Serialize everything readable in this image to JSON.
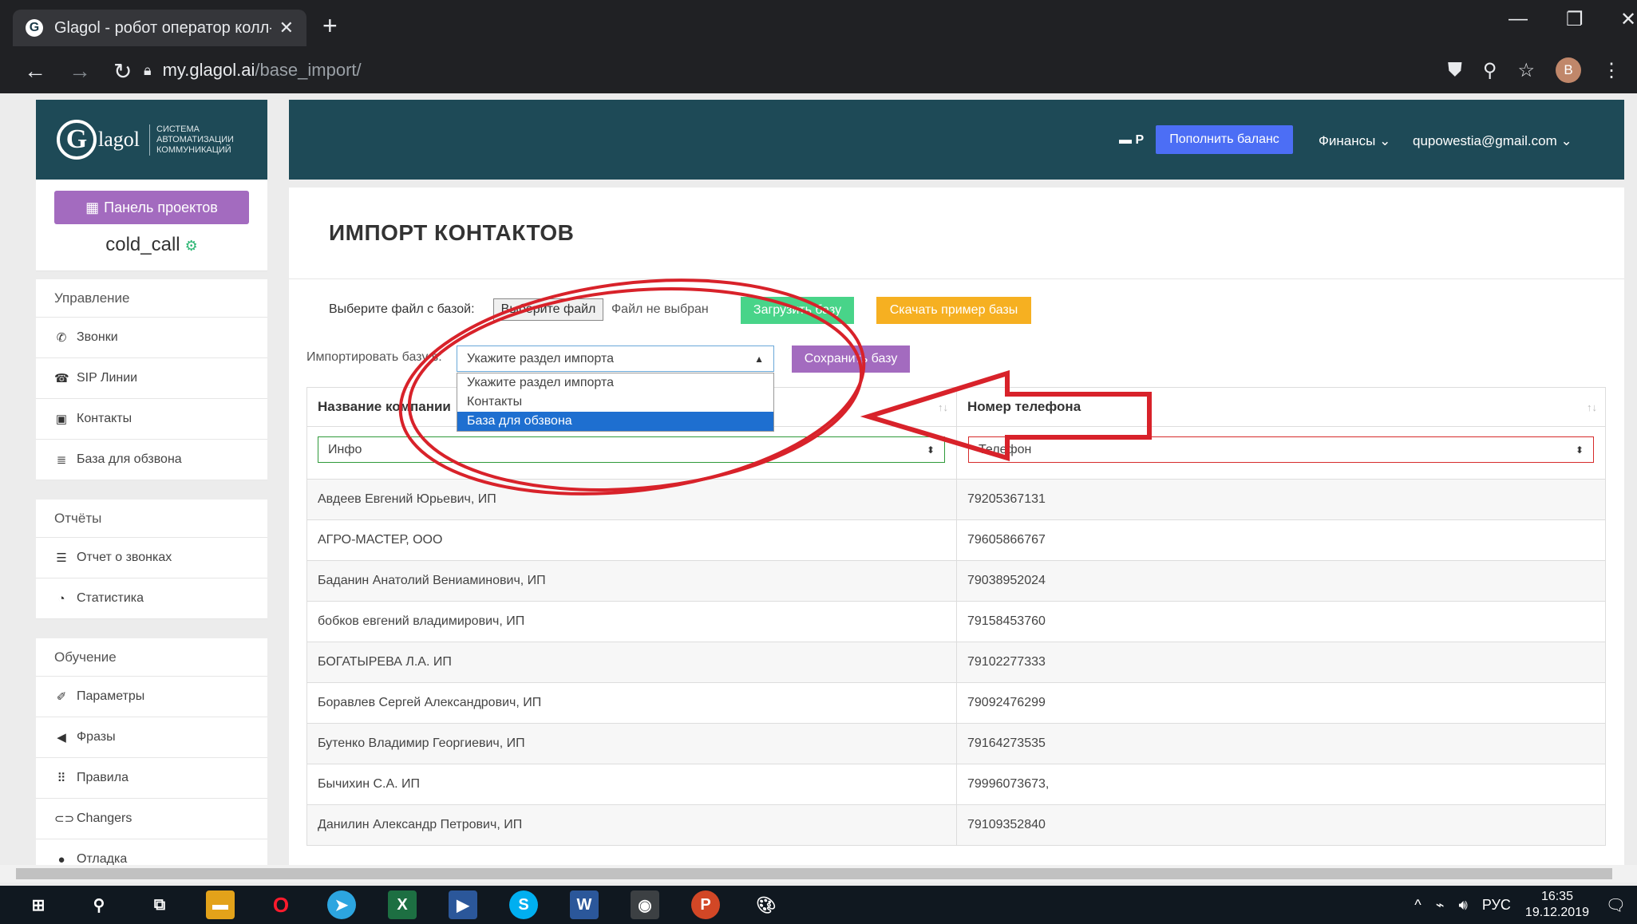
{
  "browser": {
    "tab_title": "Glagol - робот оператор колл-ц",
    "tab_close": "✕",
    "new_tab": "+",
    "url_host": "my.glagol.ai",
    "url_path": "/base_import/",
    "avatar_letter": "B",
    "win_min": "—",
    "win_restore": "❐",
    "win_close": "✕"
  },
  "logo": {
    "letter": "G",
    "word": "lagol",
    "subtitle": [
      "СИСТЕМА",
      "АВТОМАТИЗАЦИИ",
      "КОММУНИКАЦИЙ"
    ]
  },
  "sidebar": {
    "projects_button": "Панель проектов",
    "project_name": "cold_call",
    "groups": [
      {
        "title": "Управление",
        "items": [
          {
            "icon": "phone-icon",
            "glyph": "✆",
            "label": "Звонки"
          },
          {
            "icon": "sip-icon",
            "glyph": "☎",
            "label": "SIP Линии"
          },
          {
            "icon": "contacts-icon",
            "glyph": "▣",
            "label": "Контакты"
          },
          {
            "icon": "database-icon",
            "glyph": "≣",
            "label": "База для обзвона"
          }
        ]
      },
      {
        "title": "Отчёты",
        "items": [
          {
            "icon": "list-icon",
            "glyph": "☰",
            "label": "Отчет о звонках"
          },
          {
            "icon": "pie-chart-icon",
            "glyph": "◔",
            "label": "Статистика"
          }
        ]
      },
      {
        "title": "Обучение",
        "items": [
          {
            "icon": "params-icon",
            "glyph": "✐",
            "label": "Параметры"
          },
          {
            "icon": "megaphone-icon",
            "glyph": "◀",
            "label": "Фразы"
          },
          {
            "icon": "rules-icon",
            "glyph": "⠿",
            "label": "Правила"
          },
          {
            "icon": "changers-icon",
            "glyph": "⊂⊃",
            "label": "Changers"
          },
          {
            "icon": "debug-icon",
            "glyph": "●",
            "label": "Отладка"
          }
        ]
      }
    ]
  },
  "header": {
    "currency": "Р",
    "topup_button": "Пополнить баланс",
    "finance_menu": "Финансы ⌄",
    "user_email": "qupowestia@gmail.com ⌄"
  },
  "main": {
    "title": "ИМПОРТ КОНТАКТОВ",
    "file_label": "Выберите файл с базой:",
    "file_button": "Выберите файл",
    "file_none": "Файл не выбран",
    "upload_button": "Загрузить базу",
    "sample_button": "Скачать пример базы",
    "import_label": "Импортировать базу в:",
    "section_select_value": "Укажите раздел импорта",
    "save_button": "Сохранить базу",
    "dropdown_options": [
      "Укажите раздел импорта",
      "Контакты",
      "База для обзвона"
    ],
    "dropdown_selected_index": 2,
    "columns": [
      "Название компании",
      "Номер телефона"
    ],
    "col1_mapping": "Инфо",
    "col2_mapping": "Телефон",
    "rows": [
      [
        "Авдеев Евгений Юрьевич, ИП",
        "79205367131"
      ],
      [
        "АГРО-МАСТЕР, ООО",
        "79605866767"
      ],
      [
        "Баданин Анатолий Вениаминович, ИП",
        "79038952024"
      ],
      [
        "бобков евгений владимирович, ИП",
        "79158453760"
      ],
      [
        "БОГАТЫРЕВА Л.А. ИП",
        "79102277333"
      ],
      [
        "Боравлев Сергей Александрович, ИП",
        "79092476299"
      ],
      [
        "Бутенко Владимир Георгиевич, ИП",
        "79164273535"
      ],
      [
        "Бычихин С.А. ИП",
        "79996073673,"
      ],
      [
        "Данилин Александр Петрович, ИП",
        "79109352840"
      ]
    ]
  },
  "taskbar": {
    "lang": "РУС",
    "time": "16:35",
    "date": "19.12.2019"
  },
  "colors": {
    "header_bg": "#1e4a57",
    "purple": "#a36bbf",
    "blue": "#4c6ef5",
    "green": "#48d489",
    "orange": "#f6b021",
    "annotation_red": "#d8222a"
  }
}
